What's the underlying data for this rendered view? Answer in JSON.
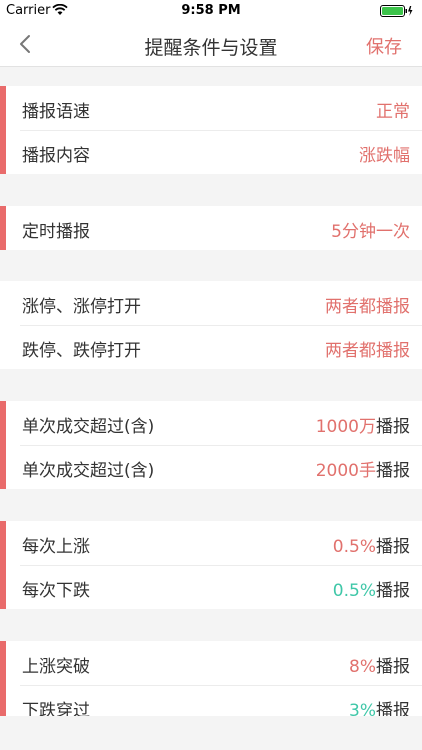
{
  "status_bar": {
    "carrier": "Carrier",
    "time": "9:58 PM"
  },
  "nav": {
    "title": "提醒条件与设置",
    "save_label": "保存"
  },
  "colors": {
    "accent": "#e96b6b",
    "value_red": "#e1716d",
    "value_green": "#3fc7a8"
  },
  "groups": [
    {
      "rows": [
        {
          "label": "播报语速",
          "value": "正常"
        },
        {
          "label": "播报内容",
          "value": "涨跌幅"
        }
      ]
    },
    {
      "rows": [
        {
          "label": "定时播报",
          "value": "5分钟一次"
        }
      ]
    },
    {
      "rows": [
        {
          "label": "涨停、涨停打开",
          "value": "两者都播报"
        },
        {
          "label": "跌停、跌停打开",
          "value": "两者都播报"
        }
      ]
    },
    {
      "rows": [
        {
          "label": "单次成交超过(含)",
          "value_num": "1000万",
          "value_suffix": "播报"
        },
        {
          "label": "单次成交超过(含)",
          "value_num": "2000手",
          "value_suffix": "播报"
        }
      ]
    },
    {
      "rows": [
        {
          "label": "每次上涨",
          "value_num": "0.5%",
          "value_suffix": "播报"
        },
        {
          "label": "每次下跌",
          "value_num": "0.5%",
          "value_suffix": "播报"
        }
      ]
    },
    {
      "rows": [
        {
          "label": "上涨突破",
          "value_num": "8%",
          "value_suffix": "播报"
        },
        {
          "label": "下跌穿过",
          "value_num": "3%",
          "value_suffix": "播报"
        }
      ]
    }
  ]
}
